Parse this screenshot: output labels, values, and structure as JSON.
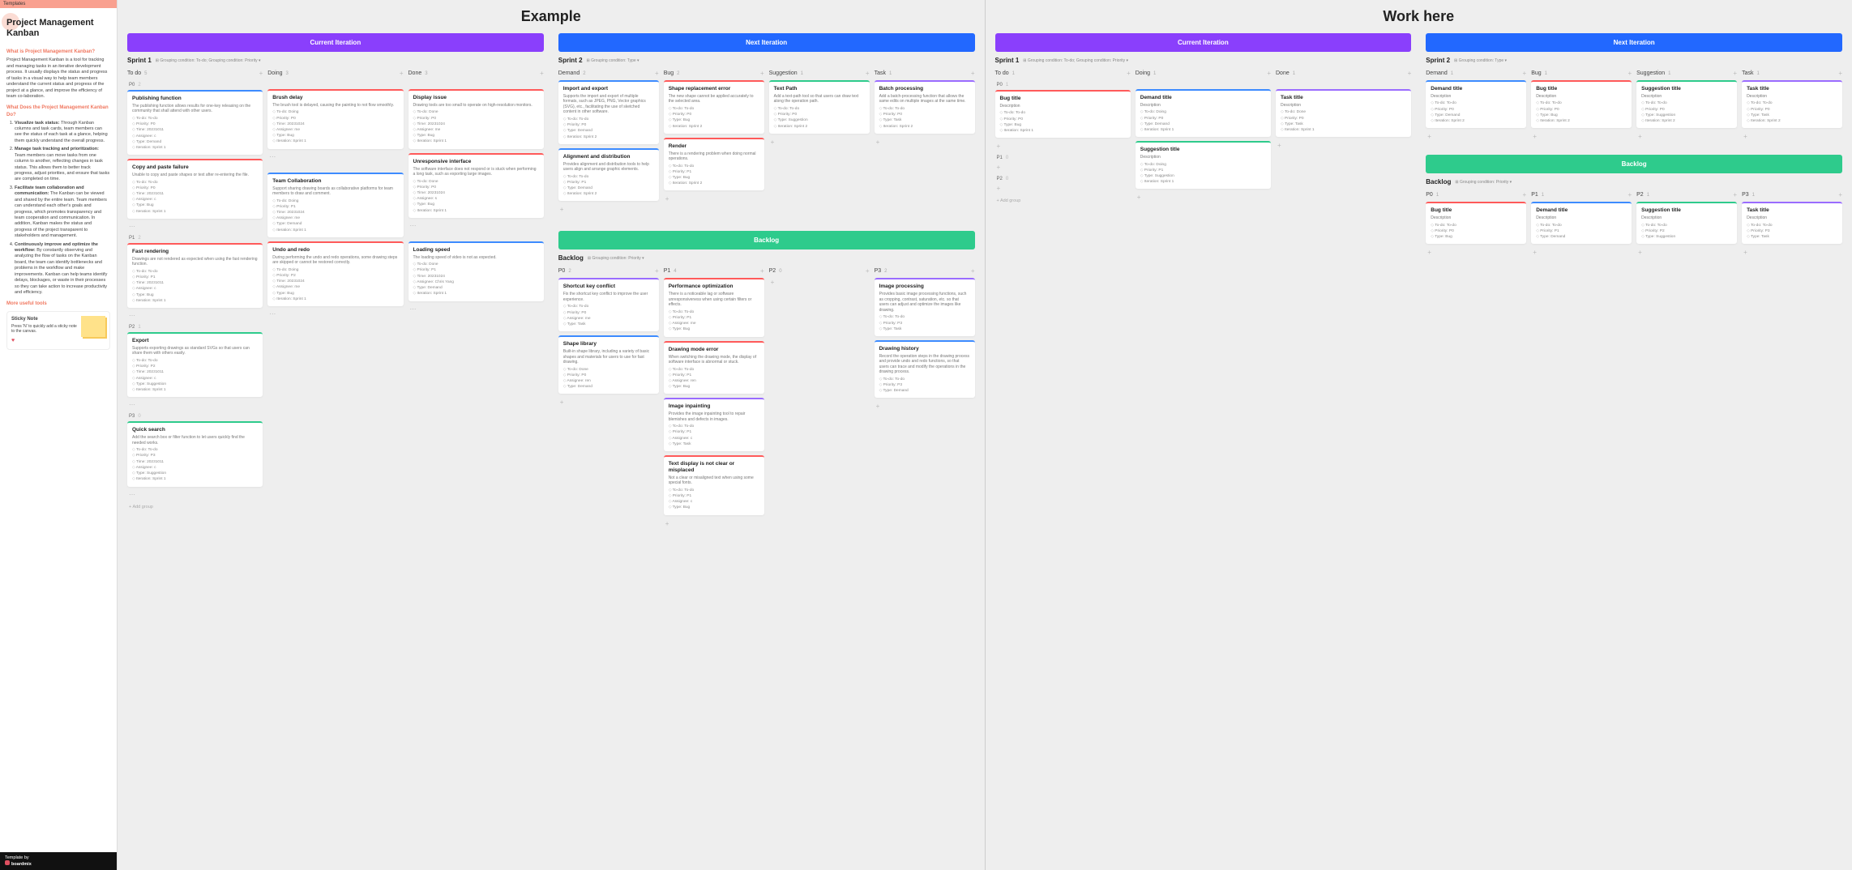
{
  "sidebar": {
    "top": "Templates",
    "title": "Project Management Kanban",
    "h_what": "What is Project Management Kanban?",
    "p_what": "Project Management Kanban is a tool for tracking and managing tasks in an iterative development process. It usually displays the status and progress of tasks in a visual way to help team members understand the current status and progress of the project at a glance, and improve the efficiency of team co-laboration.",
    "h_does": "What Does the Project Management Kanban Do?",
    "li1b": "Visualize task status:",
    "li1": " Through Kanban columns and task cards, team members can see the status of each task at a glance, helping them quickly understand the overall progress.",
    "li2b": "Manage task tracking and prioritization:",
    "li2": " Team members can move tasks from one column to another, reflecting changes in task status. This allows them to better track progress, adjust priorities, and ensure that tasks are completed on time.",
    "li3b": "Facilitate team collaboration and communication:",
    "li3": " The Kanban can be viewed and shared by the entire team. Team members can understand each other's goals and progress, which promotes transparency and team cooperation and communication. In addition, Kanban makes the status and progress of the project transparent to stakeholders and management.",
    "li4b": "Continuously improve and optimize the workflow:",
    "li4": " By constantly observing and analyzing the flow of tasks on the Kanban board, the team can identify bottlenecks and problems in the workflow and make improvements. Kanban can help teams identify delays, blockages, or waste in their processes so they can take action to increase productivity and efficiency.",
    "h_tools": "More useful tools",
    "sticky_title": "Sticky Note",
    "sticky_body": "Press 'N' to quickly add a sticky note to the canvas.",
    "foot_by": "Template by",
    "foot_brand": "boardmix"
  },
  "half_titles": {
    "left": "Example",
    "right": "Work here"
  },
  "banners": {
    "current": "Current Iteration",
    "next": "Next Iteration",
    "backlog": "Backlog"
  },
  "sprints": {
    "s1": "Sprint 1",
    "s2": "Sprint 2",
    "meta_todo": "Grouping condition: To-do; Grouping condition: Priority ▾",
    "meta_type": "Grouping condition: Type ▾",
    "meta_prio": "Grouping condition: Priority ▾"
  },
  "col": {
    "todo": "To do",
    "doing": "Doing",
    "done": "Done",
    "demand": "Demand",
    "bug": "Bug",
    "suggestion": "Suggestion",
    "task": "Task",
    "p0": "P0",
    "p1": "P1",
    "p2": "P2",
    "p3": "P3"
  },
  "group": {
    "p0": "P0",
    "p1": "P1",
    "p2": "P2",
    "p3": "P3"
  },
  "add_group": "Add group",
  "counts": {
    "todo": "5",
    "doing": "3",
    "done": "3",
    "demand": "2",
    "bug": "2",
    "suggestion": "1",
    "task": "1",
    "b_p0": "2",
    "b_p1": "4",
    "b_p2": "0",
    "b_p3": "2",
    "g_p0": "2",
    "g_p1": "2",
    "g_p2": "1",
    "g_p3": "0",
    "w_todo": "1",
    "w_doing": "1",
    "w_done": "1",
    "w_demand": "1",
    "w_bug": "1",
    "w_sug": "1",
    "w_task": "1",
    "wg_p0": "1",
    "wg_p1": "0",
    "wg_p2": "0",
    "wb_p0": "1",
    "wb_p1": "1",
    "wb_p2": "1",
    "wb_p3": "1"
  },
  "cards": {
    "publishing": {
      "title": "Publishing function",
      "desc": "The publishing function allows results for one-key releasing on the community that shall attend with other users.",
      "tags": [
        "To-do: To-do",
        "Priority: P0",
        "Time: 20231011",
        "Assignee: c",
        "Type: Demand",
        "Iteration: Sprint 1"
      ]
    },
    "copy": {
      "title": "Copy and paste failure",
      "desc": "Unable to copy and paste shapes or text after re-entering the file.",
      "tags": [
        "To-do: To-do",
        "Priority: P0",
        "Time: 20231011",
        "Assignee: c",
        "Type: Bug",
        "Iteration: Sprint 1"
      ]
    },
    "fast": {
      "title": "Fast rendering",
      "desc": "Drawings are not rendered as expected when using the fast rendering function.",
      "tags": [
        "To-do: To-do",
        "Priority: P1",
        "Time: 20231011",
        "Assignee: c",
        "Type: Bug",
        "Iteration: Sprint 1"
      ]
    },
    "export": {
      "title": "Export",
      "desc": "Supports exporting drawings as standard SVGs so that users can share them with others easily.",
      "tags": [
        "To-do: To-do",
        "Priority: P2",
        "Time: 20231011",
        "Assignee: c",
        "Type: Suggestion",
        "Iteration: Sprint 1"
      ]
    },
    "quick": {
      "title": "Quick search",
      "desc": "Add the search box or filter function to let users quickly find the needed works.",
      "tags": [
        "To-do: To-do",
        "Priority: P3",
        "Time: 20231011",
        "Assignee: c",
        "Type: Suggestion",
        "Iteration: Sprint 1"
      ]
    },
    "brush": {
      "title": "Brush delay",
      "desc": "The brush tool is delayed, causing the painting to not flow smoothly.",
      "tags": [
        "To-do: Doing",
        "Priority: P0",
        "Time: 20231024",
        "Assignee: me",
        "Type: Bug",
        "Iteration: Sprint 1"
      ]
    },
    "team": {
      "title": "Team Collaboration",
      "desc": "Support sharing drawing boards as collaborative platforms for team members to draw and comment.",
      "tags": [
        "To-do: Doing",
        "Priority: P1",
        "Time: 20231024",
        "Assignee: me",
        "Type: Demand",
        "Iteration: Sprint 1"
      ]
    },
    "undo": {
      "title": "Undo and redo",
      "desc": "During performing the undo and redo operations, some drawing steps are skipped or cannot be restored correctly.",
      "tags": [
        "To-do: Doing",
        "Priority: P2",
        "Time: 20231024",
        "Assignee: me",
        "Type: Bug",
        "Iteration: Sprint 1"
      ]
    },
    "display": {
      "title": "Display issue",
      "desc": "Drawing tools are too small to operate on high-resolution monitors.",
      "tags": [
        "To-do: Done",
        "Priority: P0",
        "Time: 20231024",
        "Assignee: me",
        "Type: Bug",
        "Iteration: Sprint 1"
      ]
    },
    "unresp": {
      "title": "Unresponsive interface",
      "desc": "The software interface does not respond or is stuck when performing a long task, such as exporting large images.",
      "tags": [
        "To-do: Done",
        "Priority: P0",
        "Time: 20231024",
        "Assignee: s",
        "Type: Bug",
        "Iteration: Sprint 1"
      ]
    },
    "loading": {
      "title": "Loading speed",
      "desc": "The loading speed of video is not as expected.",
      "tags": [
        "To-do: Done",
        "Priority: P1",
        "Time: 20231024",
        "Assignee: Chris Yang",
        "Type: Demand",
        "Iteration: Sprint 1"
      ]
    },
    "import": {
      "title": "Import and export",
      "desc": "Supports the import and export of multiple formats, such as JPEG, PNG, Vector graphics (SVG), etc., facilitating the use of sketched content in other software.",
      "tags": [
        "To-do: To-do",
        "Priority: P0",
        "Type: Demand",
        "Iteration: Sprint 2"
      ]
    },
    "align": {
      "title": "Alignment and distribution",
      "desc": "Provides alignment and distribution tools to help users align and arrange graphic elements.",
      "tags": [
        "To-do: To-do",
        "Priority: P1",
        "Type: Demand",
        "Iteration: Sprint 2"
      ]
    },
    "shape": {
      "title": "Shape replacement error",
      "desc": "The new shape cannot be applied accurately to the selected area.",
      "tags": [
        "To-do: To-do",
        "Priority: P0",
        "Type: Bug",
        "Iteration: Sprint 2"
      ]
    },
    "render": {
      "title": "Render",
      "desc": "There is a rendering problem when doing normal operations.",
      "tags": [
        "To-do: To-do",
        "Priority: P1",
        "Type: Bug",
        "Iteration: Sprint 2"
      ]
    },
    "textpath": {
      "title": "Text Path",
      "desc": "Add a text-path tool so that users can draw text along the operation path.",
      "tags": [
        "To-do: To-do",
        "Priority: P0",
        "Type: Suggestion",
        "Iteration: Sprint 2"
      ]
    },
    "batch": {
      "title": "Batch processing",
      "desc": "Add a batch-processing function that allows the same edits on multiple images at the same time.",
      "tags": [
        "To-do: To-do",
        "Priority: P0",
        "Type: Task",
        "Iteration: Sprint 2"
      ]
    },
    "shortcut": {
      "title": "Shortcut key conflict",
      "desc": "Fix the shortcut key conflict to improve the user experience.",
      "tags": [
        "To-do: To-do",
        "Priority: P0",
        "Assignee: me",
        "Type: Task"
      ]
    },
    "shapelib": {
      "title": "Shape library",
      "desc": "Built-in shape library, including a variety of basic shapes and materials for users to use for fast drawing.",
      "tags": [
        "To-do: Done",
        "Priority: P0",
        "Assignee: ren",
        "Type: Demand"
      ]
    },
    "perf": {
      "title": "Performance optimization",
      "desc": "There is a noticeable lag or software unresponsiveness when using certain filters or effects.",
      "tags": [
        "To-do: To-do",
        "Priority: P1",
        "Assignee: me",
        "Type: Bug"
      ]
    },
    "drawerr": {
      "title": "Drawing mode error",
      "desc": "When switching the drawing mode, the display of software interface is abnormal or stuck.",
      "tags": [
        "To-do: To-do",
        "Priority: P1",
        "Assignee: ren",
        "Type: Bug"
      ]
    },
    "inpaint": {
      "title": "Image inpainting",
      "desc": "Provides the image inpainting tool to repair blemishes and defects in images.",
      "tags": [
        "To-do: To-do",
        "Priority: P1",
        "Assignee: c",
        "Type: Task"
      ]
    },
    "textdisp": {
      "title": "Text display is not clear or misplaced",
      "desc": "Not a clear or misaligned text when using some special fonts.",
      "tags": [
        "To-do: To-do",
        "Priority: P1",
        "Assignee: c",
        "Type: Bug"
      ]
    },
    "imgproc": {
      "title": "Image processing",
      "desc": "Provides basic image processing functions, such as cropping, contrast, saturation, etc. so that users can adjust and optimize the images like drawing.",
      "tags": [
        "To-do: To-do",
        "Priority: P3",
        "Type: Task"
      ]
    },
    "drawhist": {
      "title": "Drawing history",
      "desc": "Record the operation steps in the drawing process and provide undo and redo functions, so that users can trace and modify the operations in the drawing process.",
      "tags": [
        "To-do: To-do",
        "Priority: P3",
        "Type: Demand"
      ]
    },
    "w_bug": {
      "title": "Bug title",
      "desc": "Description",
      "tags": [
        "To-do: To-do",
        "Priority: P0",
        "Type: Bug",
        "Iteration: Sprint 1"
      ]
    },
    "w_demand": {
      "title": "Demand title",
      "desc": "Description",
      "tags": [
        "To-do: Doing",
        "Priority: P0",
        "Type: Demand",
        "Iteration: Sprint 1"
      ]
    },
    "w_sug_doing": {
      "title": "Suggestion title",
      "desc": "Description",
      "tags": [
        "To-do: Doing",
        "Priority: P1",
        "Type: Suggestion",
        "Iteration: Sprint 1"
      ]
    },
    "w_task": {
      "title": "Task title",
      "desc": "Description",
      "tags": [
        "To-do: Done",
        "Priority: P0",
        "Type: Task",
        "Iteration: Sprint 1"
      ]
    },
    "w2_demand": {
      "title": "Demand title",
      "desc": "Description",
      "tags": [
        "To-do: To-do",
        "Priority: P0",
        "Type: Demand",
        "Iteration: Sprint 2"
      ]
    },
    "w2_bug": {
      "title": "Bug title",
      "desc": "Description",
      "tags": [
        "To-do: To-do",
        "Priority: P0",
        "Type: Bug",
        "Iteration: Sprint 2"
      ]
    },
    "w2_sug": {
      "title": "Suggestion title",
      "desc": "Description",
      "tags": [
        "To-do: To-do",
        "Priority: P0",
        "Type: Suggestion",
        "Iteration: Sprint 2"
      ]
    },
    "w2_task": {
      "title": "Task title",
      "desc": "Description",
      "tags": [
        "To-do: To-do",
        "Priority: P0",
        "Type: Task",
        "Iteration: Sprint 2"
      ]
    },
    "wb_bug": {
      "title": "Bug title",
      "desc": "Description",
      "tags": [
        "To-do: To-do",
        "Priority: P0",
        "Type: Bug"
      ]
    },
    "wb_demand": {
      "title": "Demand title",
      "desc": "Description",
      "tags": [
        "To-do: To-do",
        "Priority: P1",
        "Type: Demand"
      ]
    },
    "wb_sug": {
      "title": "Suggestion title",
      "desc": "Description",
      "tags": [
        "To-do: To-do",
        "Priority: P2",
        "Type: Suggestion"
      ]
    },
    "wb_task": {
      "title": "Task title",
      "desc": "Description",
      "tags": [
        "To-do: To-do",
        "Priority: P3",
        "Type: Task"
      ]
    }
  }
}
